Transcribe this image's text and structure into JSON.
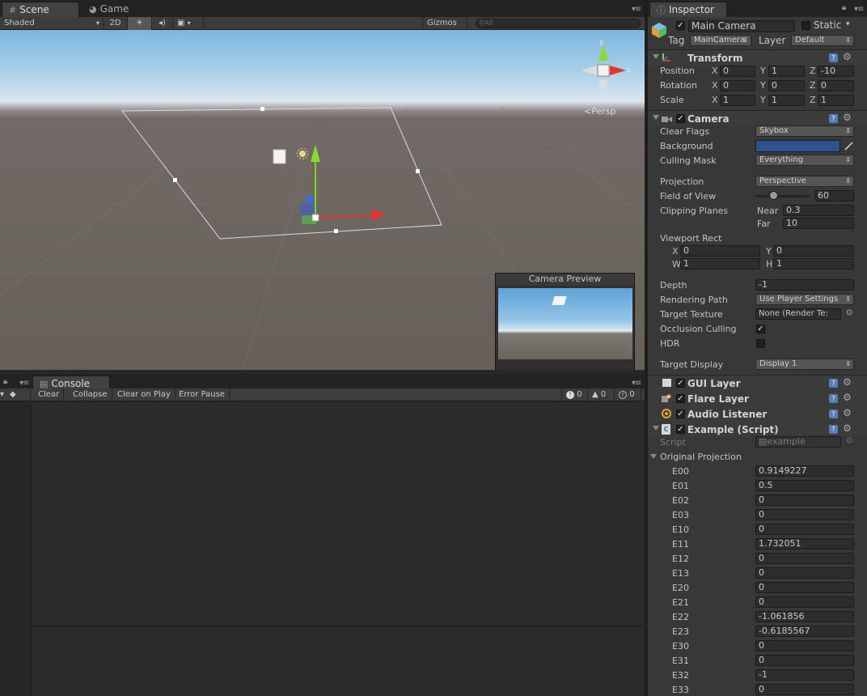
{
  "scene_panel": {
    "tabs": [
      {
        "label": "Scene",
        "icon": "grid-icon"
      },
      {
        "label": "Game",
        "icon": "pacman-icon"
      }
    ],
    "toolbar": {
      "shading": "Shaded",
      "mode_2d": "2D",
      "gizmos": "Gizmos",
      "search_placeholder": "All"
    },
    "gizmo_axes": {
      "y": "y",
      "x": "x"
    },
    "persp_label": "Persp",
    "camera_preview_title": "Camera Preview"
  },
  "console_panel": {
    "tab_label": "Console",
    "buttons": {
      "clear": "Clear",
      "collapse": "Collapse",
      "clear_on_play": "Clear on Play",
      "error_pause": "Error Pause"
    },
    "counts": {
      "errors": "0",
      "warnings": "0",
      "messages": "0"
    }
  },
  "inspector": {
    "tab_label": "Inspector",
    "object_name": "Main Camera",
    "static_label": "Static",
    "tag_label": "Tag",
    "tag_value": "MainCamera",
    "layer_label": "Layer",
    "layer_value": "Default",
    "transform": {
      "title": "Transform",
      "position": {
        "label": "Position",
        "x": "0",
        "y": "1",
        "z": "-10"
      },
      "rotation": {
        "label": "Rotation",
        "x": "0",
        "y": "0",
        "z": "0"
      },
      "scale": {
        "label": "Scale",
        "x": "1",
        "y": "1",
        "z": "1"
      }
    },
    "camera": {
      "title": "Camera",
      "clear_flags": {
        "label": "Clear Flags",
        "value": "Skybox"
      },
      "background": {
        "label": "Background",
        "color": "#30528f"
      },
      "culling_mask": {
        "label": "Culling Mask",
        "value": "Everything"
      },
      "projection": {
        "label": "Projection",
        "value": "Perspective"
      },
      "fov": {
        "label": "Field of View",
        "value": "60",
        "slider_fraction": 0.33
      },
      "clipping": {
        "label": "Clipping Planes",
        "near_label": "Near",
        "near": "0.3",
        "far_label": "Far",
        "far": "10"
      },
      "viewport": {
        "label": "Viewport Rect",
        "x": "0",
        "y": "0",
        "w": "1",
        "h": "1"
      },
      "depth": {
        "label": "Depth",
        "value": "-1"
      },
      "rendering_path": {
        "label": "Rendering Path",
        "value": "Use Player Settings"
      },
      "target_texture": {
        "label": "Target Texture",
        "value": "None (Render Te:"
      },
      "occlusion_culling": {
        "label": "Occlusion Culling",
        "checked": true
      },
      "hdr": {
        "label": "HDR",
        "checked": false
      },
      "target_display": {
        "label": "Target Display",
        "value": "Display 1"
      }
    },
    "components": [
      "GUI Layer",
      "Flare Layer",
      "Audio Listener"
    ],
    "script": {
      "title": "Example (Script)",
      "script_label": "Script",
      "script_value": "example",
      "original_projection_label": "Original Projection",
      "matrix": [
        {
          "k": "E00",
          "v": "0.9149227"
        },
        {
          "k": "E01",
          "v": "0.5"
        },
        {
          "k": "E02",
          "v": "0"
        },
        {
          "k": "E03",
          "v": "0"
        },
        {
          "k": "E10",
          "v": "0"
        },
        {
          "k": "E11",
          "v": "1.732051"
        },
        {
          "k": "E12",
          "v": "0"
        },
        {
          "k": "E13",
          "v": "0"
        },
        {
          "k": "E20",
          "v": "0"
        },
        {
          "k": "E21",
          "v": "0"
        },
        {
          "k": "E22",
          "v": "-1.061856"
        },
        {
          "k": "E23",
          "v": "-0.6185567"
        },
        {
          "k": "E30",
          "v": "0"
        },
        {
          "k": "E31",
          "v": "0"
        },
        {
          "k": "E32",
          "v": "-1"
        },
        {
          "k": "E33",
          "v": "0"
        }
      ]
    }
  }
}
